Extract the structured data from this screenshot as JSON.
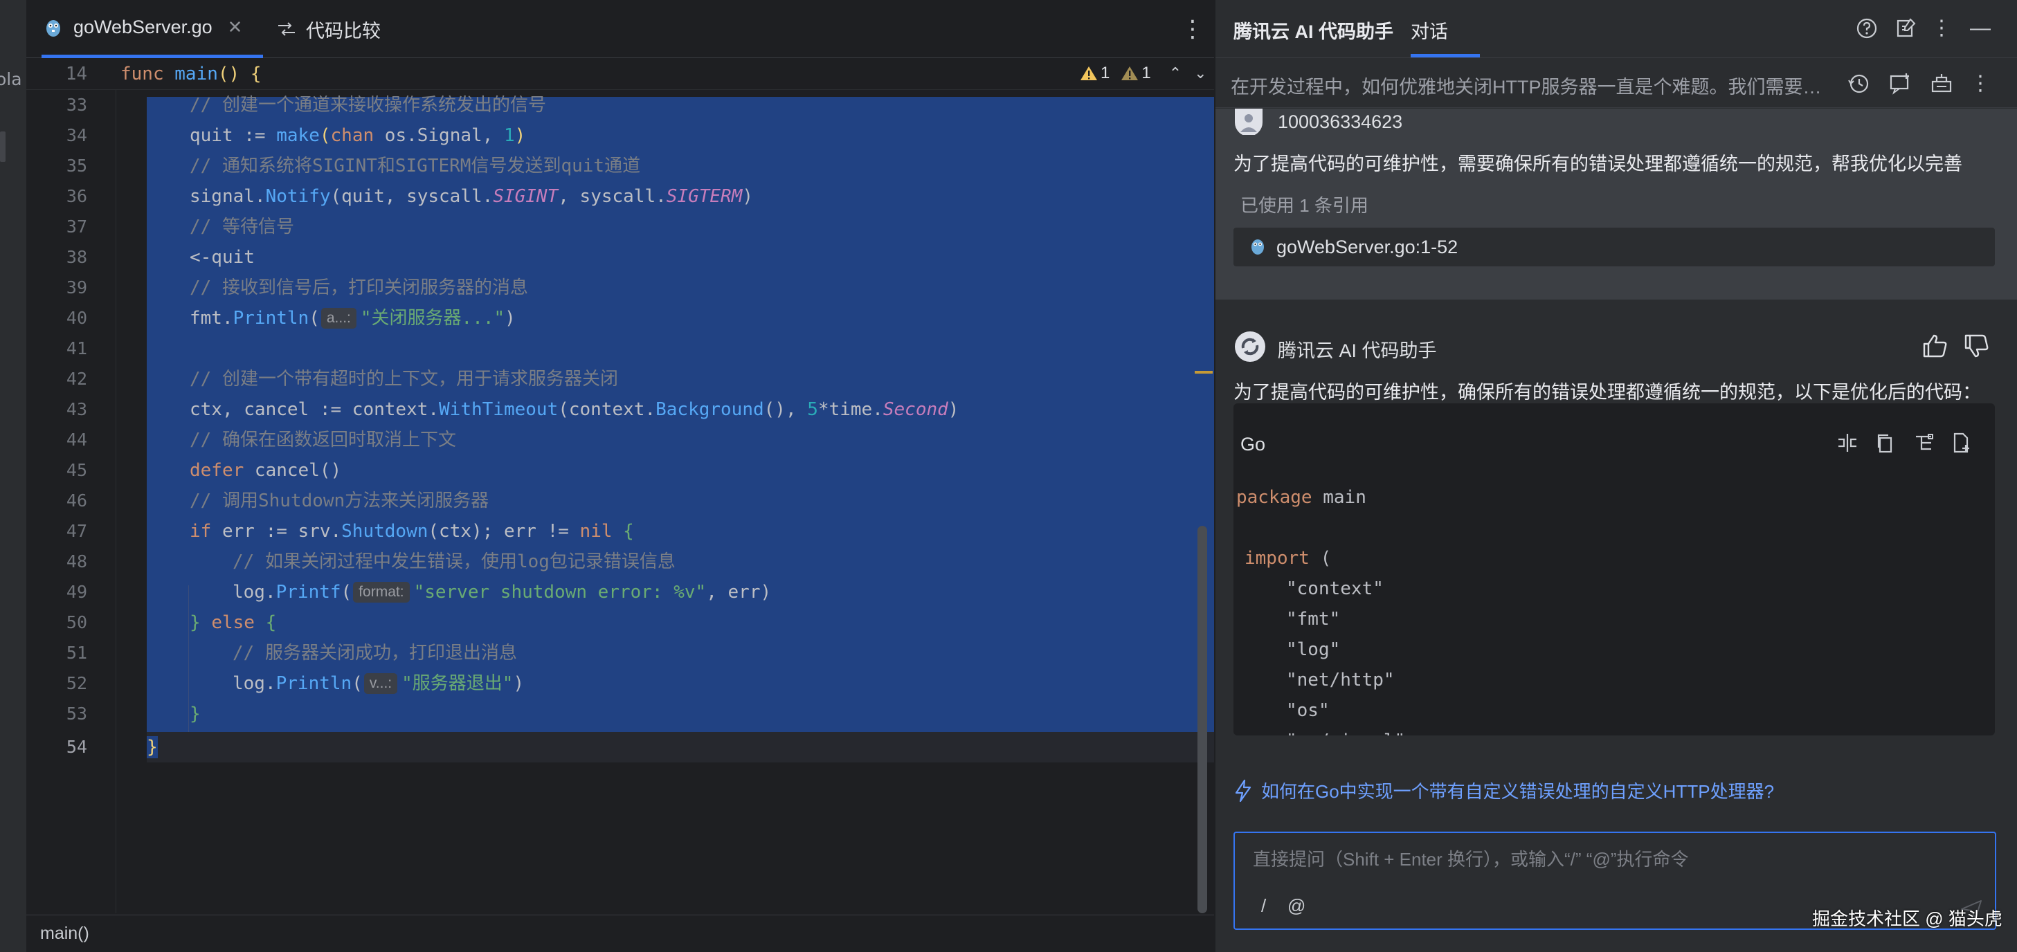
{
  "editor": {
    "tabs": [
      {
        "label": "goWebServer.go",
        "active": true
      },
      {
        "label": "代码比较",
        "active": false
      }
    ],
    "left_cut_label": "ola",
    "sticky": {
      "line": "14",
      "code_kw": "func ",
      "code_fn": "main",
      "code_rest": "() {"
    },
    "inspections": {
      "warnings": "1",
      "weak_warnings": "1"
    },
    "breadcrumb": "main()",
    "line_numbers": [
      "33",
      "34",
      "35",
      "36",
      "37",
      "38",
      "39",
      "40",
      "41",
      "42",
      "43",
      "44",
      "45",
      "46",
      "47",
      "48",
      "49",
      "50",
      "51",
      "52",
      "53",
      "54"
    ],
    "lines": {
      "l33": "// 创建一个通道来接收操作系统发出的信号",
      "l34a": "quit := ",
      "l34b": "make",
      "l34c": "(",
      "l34d": "chan",
      "l34e": " os.Signal, ",
      "l34f": "1",
      "l34g": ")",
      "l35": "// 通知系统将SIGINT和SIGTERM信号发送到quit通道",
      "l36a": "signal.",
      "l36b": "Notify",
      "l36c": "(quit, syscall.",
      "l36d": "SIGINT",
      "l36e": ", syscall.",
      "l36f": "SIGTERM",
      "l36g": ")",
      "l37": "// 等待信号",
      "l38": "<-quit",
      "l39": "// 接收到信号后，打印关闭服务器的消息",
      "l40a": "fmt.",
      "l40b": "Println",
      "l40c": "(",
      "l40hint": "a...:",
      "l40d": "\"关闭服务器...\"",
      "l40e": ")",
      "l42": "// 创建一个带有超时的上下文，用于请求服务器关闭",
      "l43a": "ctx, cancel := context.",
      "l43b": "WithTimeout",
      "l43c": "(context.",
      "l43d": "Background",
      "l43e": "(), ",
      "l43f": "5",
      "l43g": "*time.",
      "l43h": "Second",
      "l43i": ")",
      "l44": "// 确保在函数返回时取消上下文",
      "l45a": "defer",
      "l45b": " cancel()",
      "l46": "// 调用Shutdown方法来关闭服务器",
      "l47a": "if",
      "l47b": " err := srv.",
      "l47c": "Shutdown",
      "l47d": "(ctx); err != ",
      "l47e": "nil",
      "l47f": " {",
      "l48": "// 如果关闭过程中发生错误，使用log包记录错误信息",
      "l49a": "log.",
      "l49b": "Printf",
      "l49c": "(",
      "l49hint": "format:",
      "l49d": "\"server shutdown error: %v\"",
      "l49e": ", err)",
      "l50a": "} ",
      "l50b": "else",
      "l50c": " {",
      "l51": "// 服务器关闭成功，打印退出消息",
      "l52a": "log.",
      "l52b": "Println",
      "l52c": "(",
      "l52hint": "v...:",
      "l52d": "\"服务器退出\"",
      "l52e": ")",
      "l53": "}",
      "l54": "}"
    }
  },
  "panel": {
    "title": "腾讯云 AI 代码助手",
    "tab": "对话",
    "session_title": "在开发过程中，如何优雅地关闭HTTP服务器一直是个难题。我们需要一种...",
    "user": {
      "name": "100036334623",
      "message": "为了提高代码的可维护性，需要确保所有的错误处理都遵循统一的规范，帮我优化以完善",
      "ref_note": "已使用 1 条引用",
      "ref_file": "goWebServer.go:1-52"
    },
    "assistant": {
      "name": "腾讯云 AI 代码助手",
      "message": "为了提高代码的可维护性，确保所有的错误处理都遵循统一的规范，以下是优化后的代码：",
      "code_lang": "Go",
      "code": {
        "c1a": "package",
        "c1b": " main",
        "c3a": "import",
        "c3b": " (",
        "c4": "\"context\"",
        "c5": "\"fmt\"",
        "c6": "\"log\"",
        "c7": "\"net/http\"",
        "c8": "\"os\"",
        "c9": "\"os/signal\""
      }
    },
    "suggestion": "如何在Go中实现一个带有自定义错误处理的自定义HTTP处理器?",
    "input": {
      "placeholder": "直接提问（Shift + Enter 换行），或输入“/” “@”执行命令",
      "slash": "/",
      "at": "@"
    }
  },
  "watermark": "掘金技术社区 @ 猫头虎",
  "colors": {
    "accent": "#3574f0",
    "selection": "#214283",
    "keyword": "#cf8e6d",
    "function": "#56a8f5",
    "string": "#6aab73",
    "comment": "#7a7e85"
  }
}
